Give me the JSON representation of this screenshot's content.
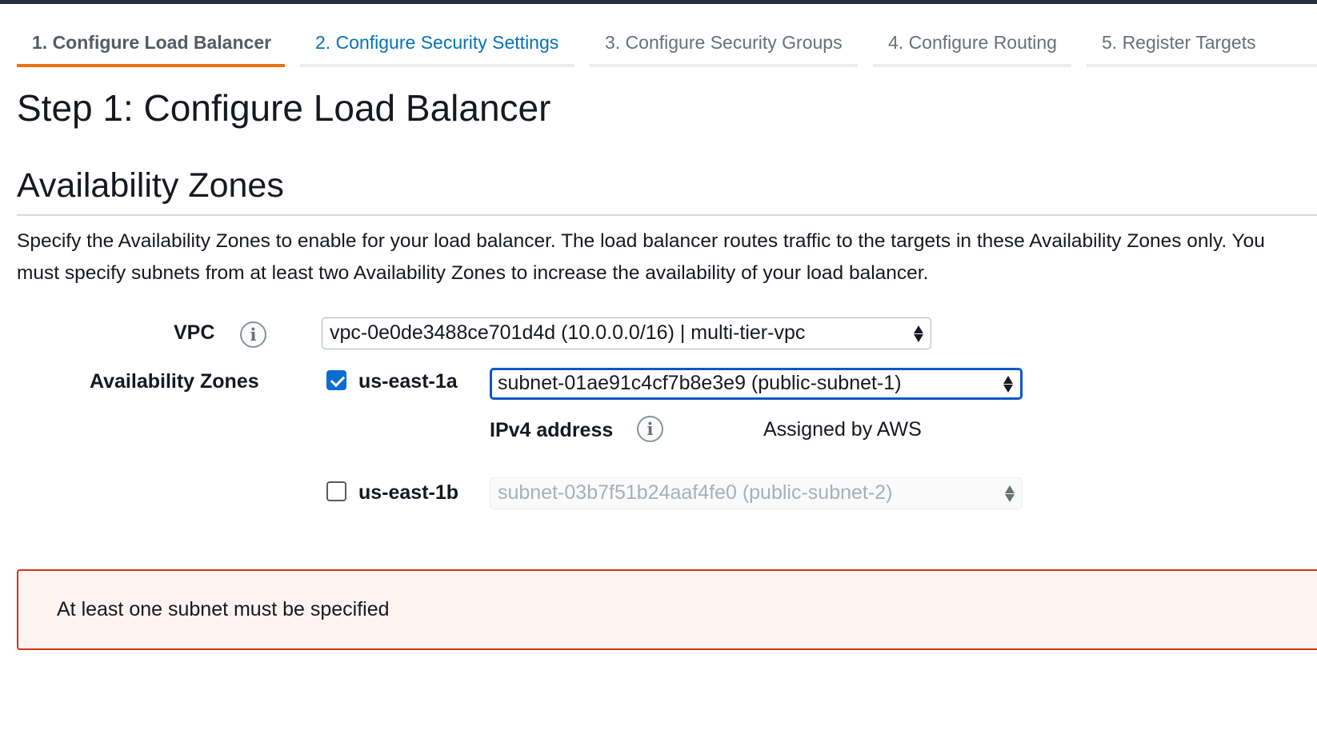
{
  "wizard": {
    "tabs": [
      {
        "label": "1. Configure Load Balancer",
        "state": "active"
      },
      {
        "label": "2. Configure Security Settings",
        "state": "link"
      },
      {
        "label": "3. Configure Security Groups",
        "state": "inactive"
      },
      {
        "label": "4. Configure Routing",
        "state": "inactive"
      },
      {
        "label": "5. Register Targets",
        "state": "inactive"
      }
    ]
  },
  "step_title": "Step 1: Configure Load Balancer",
  "availability_zones": {
    "section_title": "Availability Zones",
    "description_lines": [
      "Specify the Availability Zones to enable for your load balancer. The load balancer routes traffic to the targets in these Availability Zones only. You",
      "must specify subnets from at least two Availability Zones to increase the availability of your load balancer."
    ],
    "vpc": {
      "label": "VPC",
      "info_icon": "info-icon",
      "selected": "vpc-0e0de3488ce701d4d (10.0.0.0/16) | multi-tier-vpc"
    },
    "zones_label": "Availability Zones",
    "zones": [
      {
        "name": "us-east-1a",
        "checked": true,
        "subnet": "subnet-01ae91c4cf7b8e3e9 (public-subnet-1)",
        "ipv4_label": "IPv4 address",
        "ipv4_value": "Assigned by AWS"
      },
      {
        "name": "us-east-1b",
        "checked": false,
        "subnet": "subnet-03b7f51b24aaf4fe0 (public-subnet-2)"
      }
    ]
  },
  "error": {
    "message": "At least one subnet must be specified"
  },
  "colors": {
    "accent_tab": "#ec7211",
    "link": "#0073bb",
    "focus": "#0a57c2",
    "error_border": "#d13212",
    "checkbox": "#0a6ed1"
  }
}
